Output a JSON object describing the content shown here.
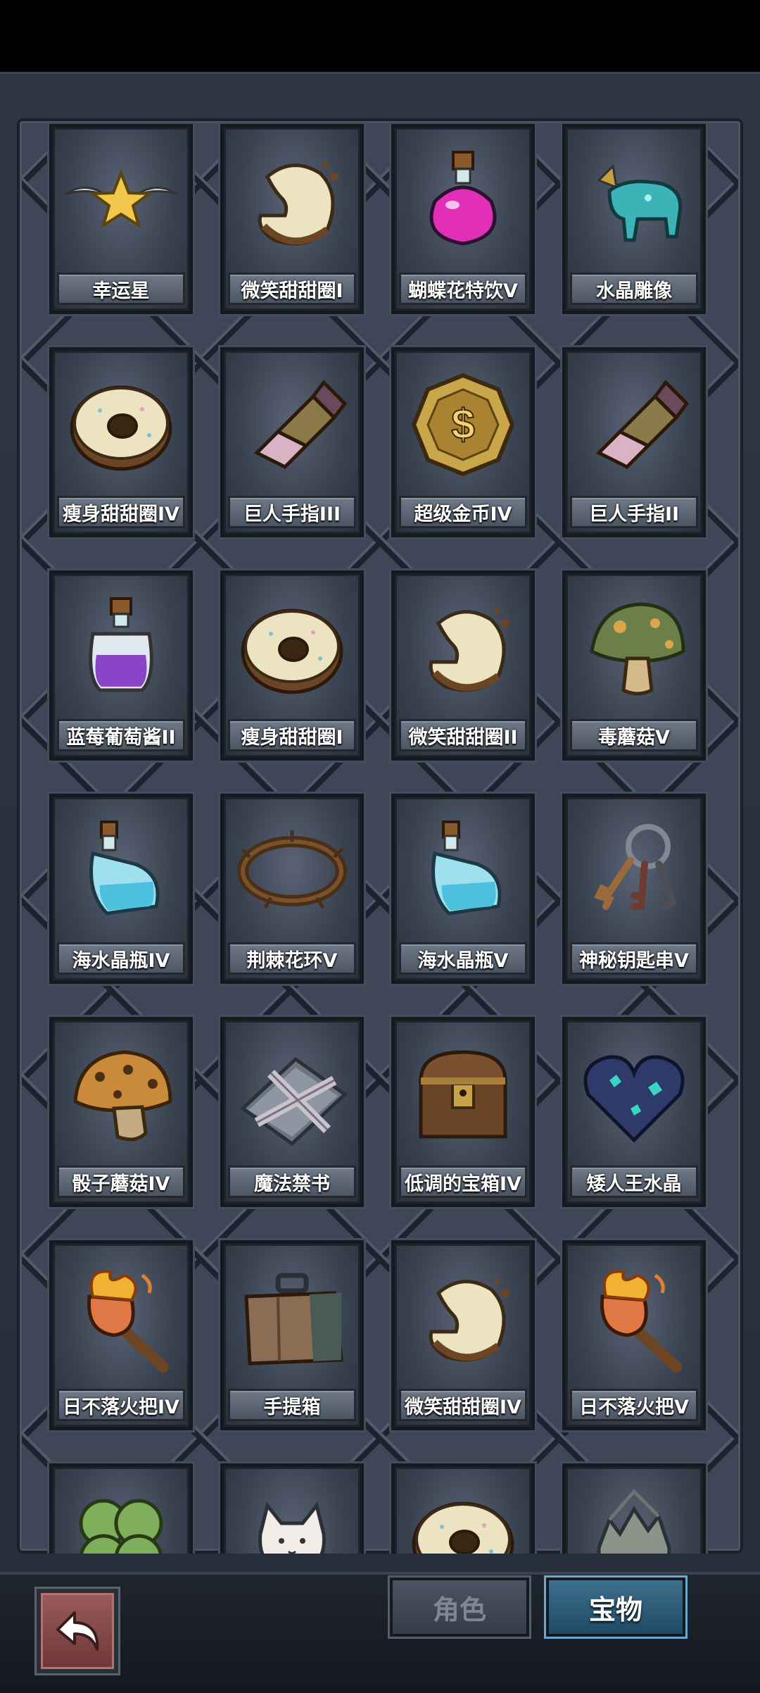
{
  "grid": {
    "items": [
      {
        "label": "幸运星",
        "icon": "lucky-star-icon"
      },
      {
        "label": "微笑甜甜圈I",
        "icon": "bitten-donut-icon"
      },
      {
        "label": "蝴蝶花特饮V",
        "icon": "pink-potion-icon"
      },
      {
        "label": "水晶雕像",
        "icon": "crystal-bull-statue-icon"
      },
      {
        "label": "瘦身甜甜圈IV",
        "icon": "donut-icon"
      },
      {
        "label": "巨人手指III",
        "icon": "giant-finger-icon"
      },
      {
        "label": "超级金币IV",
        "icon": "gold-coin-icon"
      },
      {
        "label": "巨人手指II",
        "icon": "giant-finger-icon"
      },
      {
        "label": "蓝莓葡萄酱II",
        "icon": "purple-potion-icon"
      },
      {
        "label": "瘦身甜甜圈I",
        "icon": "donut-icon"
      },
      {
        "label": "微笑甜甜圈II",
        "icon": "bitten-donut-icon"
      },
      {
        "label": "毒蘑菇V",
        "icon": "poison-mushroom-icon"
      },
      {
        "label": "海水晶瓶IV",
        "icon": "blue-bottle-icon"
      },
      {
        "label": "荆棘花环V",
        "icon": "thorn-wreath-icon"
      },
      {
        "label": "海水晶瓶V",
        "icon": "blue-bottle-icon"
      },
      {
        "label": "神秘钥匙串V",
        "icon": "key-ring-icon"
      },
      {
        "label": "骰子蘑菇IV",
        "icon": "dice-mushroom-icon"
      },
      {
        "label": "魔法禁书",
        "icon": "forbidden-book-icon"
      },
      {
        "label": "低调的宝箱IV",
        "icon": "treasure-chest-icon"
      },
      {
        "label": "矮人王水晶",
        "icon": "dwarf-crystal-heart-icon"
      },
      {
        "label": "日不落火把IV",
        "icon": "torch-icon"
      },
      {
        "label": "手提箱",
        "icon": "suitcase-icon"
      },
      {
        "label": "微笑甜甜圈IV",
        "icon": "bitten-donut-icon"
      },
      {
        "label": "日不落火把V",
        "icon": "torch-icon"
      },
      {
        "label": "",
        "icon": "four-leaf-clover-icon"
      },
      {
        "label": "",
        "icon": "lucky-cat-icon"
      },
      {
        "label": "",
        "icon": "donut-icon"
      },
      {
        "label": "",
        "icon": "cracked-egg-icon"
      }
    ]
  },
  "nav": {
    "back_icon": "back-arrow-icon",
    "tabs": [
      {
        "label": "角色",
        "active": false
      },
      {
        "label": "宝物",
        "active": true
      }
    ]
  },
  "colors": {
    "active_tab": "#2a5a7a",
    "back_button": "#8a4a4a",
    "panel": "#2e3745"
  }
}
